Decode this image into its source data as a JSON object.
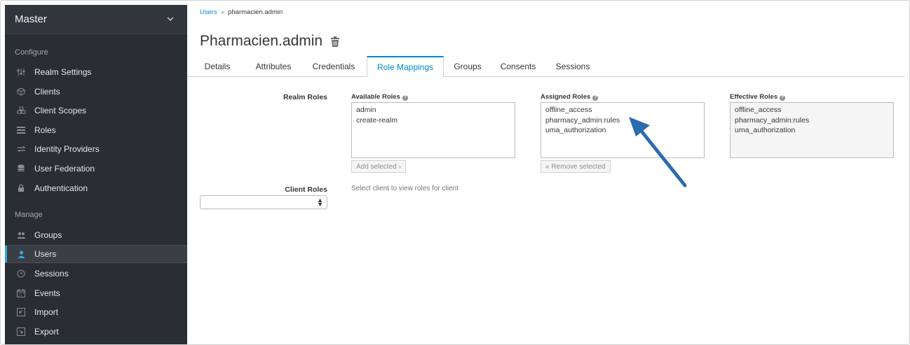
{
  "sidebar": {
    "realm": "Master",
    "configure_label": "Configure",
    "manage_label": "Manage",
    "configure_items": [
      {
        "label": "Realm Settings",
        "icon": "sliders-icon"
      },
      {
        "label": "Clients",
        "icon": "cube-icon"
      },
      {
        "label": "Client Scopes",
        "icon": "cubes-icon"
      },
      {
        "label": "Roles",
        "icon": "list-icon"
      },
      {
        "label": "Identity Providers",
        "icon": "exchange-icon"
      },
      {
        "label": "User Federation",
        "icon": "database-icon"
      },
      {
        "label": "Authentication",
        "icon": "lock-icon"
      }
    ],
    "manage_items": [
      {
        "label": "Groups",
        "icon": "users-icon"
      },
      {
        "label": "Users",
        "icon": "user-icon"
      },
      {
        "label": "Sessions",
        "icon": "clock-icon"
      },
      {
        "label": "Events",
        "icon": "calendar-icon"
      },
      {
        "label": "Import",
        "icon": "import-icon"
      },
      {
        "label": "Export",
        "icon": "export-icon"
      }
    ],
    "active_item": "Users"
  },
  "breadcrumb": {
    "link": "Users",
    "separator": "»",
    "current": "pharmacien.admin"
  },
  "page_title": "Pharmacien.admin",
  "tabs": [
    "Details",
    "Attributes",
    "Credentials",
    "Role Mappings",
    "Groups",
    "Consents",
    "Sessions"
  ],
  "active_tab": "Role Mappings",
  "realm_roles": {
    "label": "Realm Roles",
    "available": {
      "label": "Available Roles",
      "items": [
        "admin",
        "create-realm"
      ],
      "button": "Add selected ›"
    },
    "assigned": {
      "label": "Assigned Roles",
      "items": [
        "offline_access",
        "pharmacy_admin:rules",
        "uma_authorization"
      ],
      "button": "« Remove selected"
    },
    "effective": {
      "label": "Effective Roles",
      "items": [
        "offline_access",
        "pharmacy_admin:rules",
        "uma_authorization"
      ]
    }
  },
  "client_roles": {
    "label": "Client Roles",
    "selected": "",
    "hint": "Select client to view roles for client"
  },
  "colors": {
    "sidebar_bg": "#292e34",
    "accent": "#39a5dc",
    "link": "#0088ce",
    "annotation_arrow": "#2b6cb0"
  }
}
